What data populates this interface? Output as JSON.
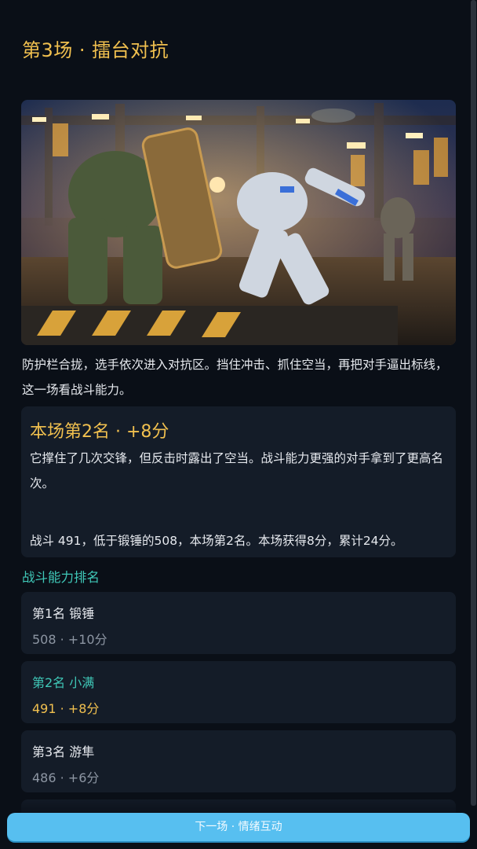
{
  "header": {
    "title": "第3场 · 擂台对抗"
  },
  "intro": {
    "text": "防护栏合拢，选手依次进入对抗区。挡住冲击、抓住空当，再把对手逼出标线，这一场看战斗能力。"
  },
  "result": {
    "heading": "本场第2名 · +8分",
    "description": "它撑住了几次交锋，但反击时露出了空当。战斗能力更强的对手拿到了更高名次。",
    "stat_line": "战斗 491，低于锻锤的508，本场第2名。本场获得8分，累计24分。"
  },
  "ranking": {
    "label": "战斗能力排名",
    "items": [
      {
        "title": "第1名  锻锤",
        "detail": "508 · +10分"
      },
      {
        "title": "第2名  小满",
        "detail": "491 · +8分"
      },
      {
        "title": "第3名  游隼",
        "detail": "486 · +6分"
      }
    ]
  },
  "footer": {
    "next_label": "下一场 · 情绪互动"
  },
  "colors": {
    "background": "#0a0f17",
    "card": "#141c28",
    "accent_gold": "#f1c04f",
    "accent_teal": "#3fc7b7",
    "button": "#57bff0"
  },
  "image": {
    "subject": "battle-arena-mech-illustration"
  }
}
